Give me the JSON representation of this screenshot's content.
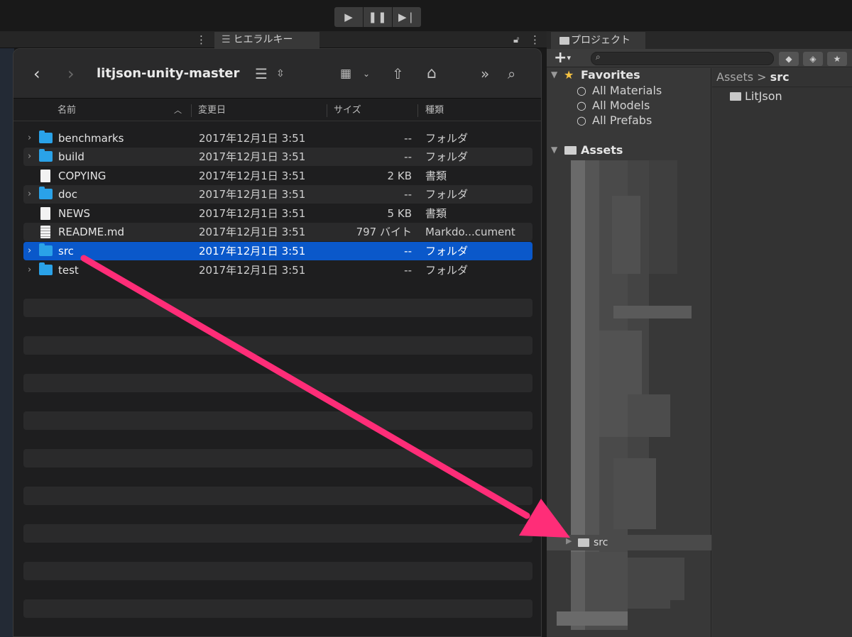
{
  "unity": {
    "play_controls": [
      "play-icon",
      "pause-icon",
      "step-icon"
    ],
    "hierarchy_tab": "ヒエラルキー",
    "project_tab": "プロジェクト"
  },
  "finder": {
    "title": "litjson-unity-master",
    "columns": {
      "name": "名前",
      "date": "変更日",
      "size": "サイズ",
      "kind": "種類"
    },
    "rows": [
      {
        "name": "benchmarks",
        "date": "2017年12月1日 3:51",
        "size": "--",
        "kind": "フォルダ",
        "type": "folder"
      },
      {
        "name": "build",
        "date": "2017年12月1日 3:51",
        "size": "--",
        "kind": "フォルダ",
        "type": "folder"
      },
      {
        "name": "COPYING",
        "date": "2017年12月1日 3:51",
        "size": "2 KB",
        "kind": "書類",
        "type": "doc"
      },
      {
        "name": "doc",
        "date": "2017年12月1日 3:51",
        "size": "--",
        "kind": "フォルダ",
        "type": "folder"
      },
      {
        "name": "NEWS",
        "date": "2017年12月1日 3:51",
        "size": "5 KB",
        "kind": "書類",
        "type": "doc"
      },
      {
        "name": "README.md",
        "date": "2017年12月1日 3:51",
        "size": "797 バイト",
        "kind": "Markdo...cument",
        "type": "md"
      },
      {
        "name": "src",
        "date": "2017年12月1日 3:51",
        "size": "--",
        "kind": "フォルダ",
        "type": "folder",
        "selected": true
      },
      {
        "name": "test",
        "date": "2017年12月1日 3:51",
        "size": "--",
        "kind": "フォルダ",
        "type": "folder"
      }
    ]
  },
  "project": {
    "favorites_label": "Favorites",
    "favorites": [
      "All Materials",
      "All Models",
      "All Prefabs"
    ],
    "assets_label": "Assets",
    "breadcrumb": {
      "root": "Assets",
      "separator": ">",
      "current": "src"
    },
    "right_items": [
      "LitJson"
    ],
    "dropped_folder": "src",
    "add_label": "+"
  },
  "colors": {
    "selection": "#0a58ca",
    "arrow": "#ff2d78",
    "folder": "#2aa2e8"
  }
}
